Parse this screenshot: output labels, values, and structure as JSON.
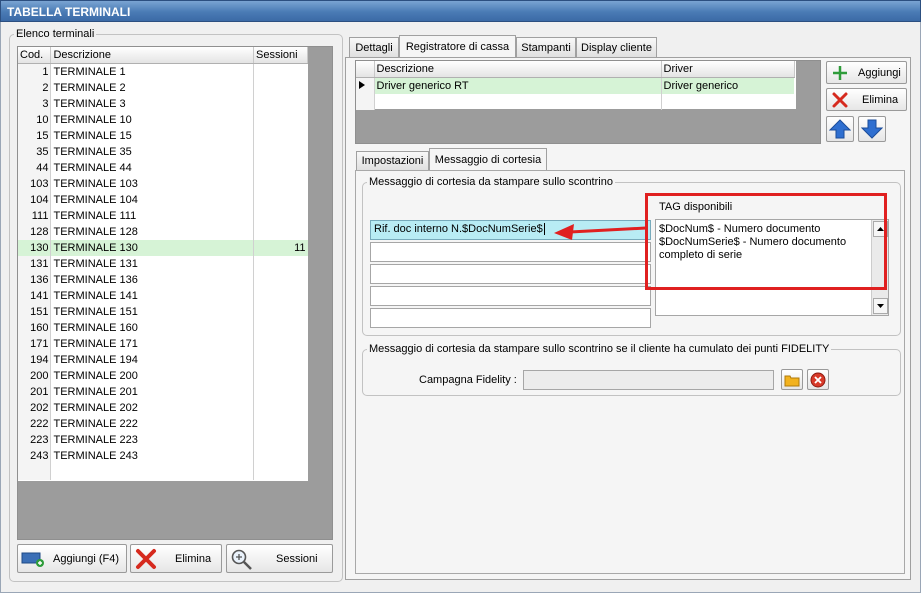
{
  "window": {
    "title": "TABELLA TERMINALI"
  },
  "left_panel": {
    "group_title": "Elenco terminali",
    "columns": [
      "Cod.",
      "Descrizione",
      "Sessioni"
    ],
    "rows": [
      {
        "code": "1",
        "desc": "TERMINALE 1",
        "sessions": ""
      },
      {
        "code": "2",
        "desc": "TERMINALE 2",
        "sessions": ""
      },
      {
        "code": "3",
        "desc": "TERMINALE 3",
        "sessions": ""
      },
      {
        "code": "10",
        "desc": "TERMINALE 10",
        "sessions": ""
      },
      {
        "code": "15",
        "desc": "TERMINALE 15",
        "sessions": ""
      },
      {
        "code": "35",
        "desc": "TERMINALE 35",
        "sessions": ""
      },
      {
        "code": "44",
        "desc": "TERMINALE 44",
        "sessions": ""
      },
      {
        "code": "103",
        "desc": "TERMINALE 103",
        "sessions": ""
      },
      {
        "code": "104",
        "desc": "TERMINALE 104",
        "sessions": ""
      },
      {
        "code": "111",
        "desc": "TERMINALE 111",
        "sessions": ""
      },
      {
        "code": "128",
        "desc": "TERMINALE 128",
        "sessions": ""
      },
      {
        "code": "130",
        "desc": "TERMINALE 130",
        "sessions": "11"
      },
      {
        "code": "131",
        "desc": "TERMINALE 131",
        "sessions": ""
      },
      {
        "code": "136",
        "desc": "TERMINALE 136",
        "sessions": ""
      },
      {
        "code": "141",
        "desc": "TERMINALE 141",
        "sessions": ""
      },
      {
        "code": "151",
        "desc": "TERMINALE 151",
        "sessions": ""
      },
      {
        "code": "160",
        "desc": "TERMINALE 160",
        "sessions": ""
      },
      {
        "code": "171",
        "desc": "TERMINALE 171",
        "sessions": ""
      },
      {
        "code": "194",
        "desc": "TERMINALE 194",
        "sessions": ""
      },
      {
        "code": "200",
        "desc": "TERMINALE 200",
        "sessions": ""
      },
      {
        "code": "201",
        "desc": "TERMINALE 201",
        "sessions": ""
      },
      {
        "code": "202",
        "desc": "TERMINALE 202",
        "sessions": ""
      },
      {
        "code": "222",
        "desc": "TERMINALE 222",
        "sessions": ""
      },
      {
        "code": "223",
        "desc": "TERMINALE 223",
        "sessions": ""
      },
      {
        "code": "243",
        "desc": "TERMINALE 243",
        "sessions": ""
      }
    ],
    "selected_code": "130",
    "buttons": {
      "add": "Aggiungi (F4)",
      "delete": "Elimina",
      "sessions": "Sessioni"
    }
  },
  "tabs": [
    "Dettagli",
    "Registratore di cassa",
    "Stampanti",
    "Display cliente"
  ],
  "active_tab": "Registratore di cassa",
  "drivers": {
    "columns": [
      "Descrizione",
      "Driver"
    ],
    "rows": [
      {
        "desc": "Driver generico RT",
        "driver": "Driver generico"
      }
    ],
    "buttons": {
      "add": "Aggiungi",
      "delete": "Elimina"
    }
  },
  "subtabs": [
    "Impostazioni",
    "Messaggio di cortesia"
  ],
  "active_subtab": "Messaggio di cortesia",
  "courtesy": {
    "group_title": "Messaggio di cortesia da stampare sullo scontrino",
    "lines": [
      "Rif. doc interno N.$DocNumSerie$",
      "",
      "",
      "",
      ""
    ],
    "tags_title": "TAG disponibili",
    "tags_text": [
      "$DocNum$ - Numero documento",
      "$DocNumSerie$ - Numero documento",
      "completo di serie"
    ]
  },
  "fidelity": {
    "group_title": "Messaggio di cortesia da stampare sullo scontrino se il cliente ha cumulato dei punti FIDELITY",
    "campaign_label": "Campagna Fidelity :",
    "campaign_value": ""
  },
  "colors": {
    "accent_red": "#e02020",
    "selection_green": "#d6f3d6",
    "highlight_cyan": "#b8ecf4",
    "title_blue": "#4a7bb5"
  }
}
